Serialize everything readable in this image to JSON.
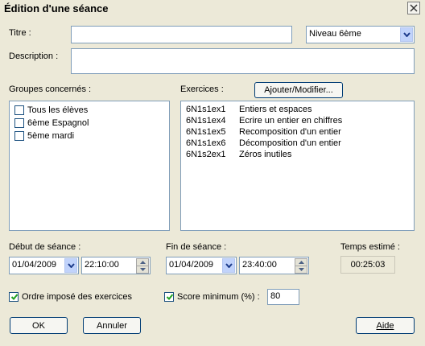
{
  "window": {
    "title": "Édition d'une séance"
  },
  "form": {
    "titre_label": "Titre :",
    "titre_value": "",
    "niveau_value": "Niveau 6ème",
    "description_label": "Description :",
    "description_value": ""
  },
  "groupes": {
    "label": "Groupes concernés :",
    "items": [
      {
        "label": "Tous les élèves",
        "checked": false
      },
      {
        "label": "6ème Espagnol",
        "checked": false
      },
      {
        "label": "5ème mardi",
        "checked": false
      }
    ]
  },
  "exercices": {
    "label": "Exercices :",
    "button_label": "Ajouter/Modifier...",
    "items": [
      {
        "code": "6N1s1ex1",
        "title": "Entiers et espaces"
      },
      {
        "code": "6N1s1ex4",
        "title": "Ecrire un entier en chiffres"
      },
      {
        "code": "6N1s1ex5",
        "title": "Recomposition d'un entier"
      },
      {
        "code": "6N1s1ex6",
        "title": "Décomposition d'un entier"
      },
      {
        "code": "6N1s2ex1",
        "title": "Zéros inutiles"
      }
    ]
  },
  "debut": {
    "label": "Début de séance :",
    "date": "01/04/2009",
    "time": "22:10:00"
  },
  "fin": {
    "label": "Fin de séance :",
    "date": "01/04/2009",
    "time": "23:40:00"
  },
  "temps": {
    "label": "Temps estimé :",
    "value": "00:25:03"
  },
  "options": {
    "ordre_label": "Ordre imposé des exercices",
    "ordre_checked": true,
    "score_label": "Score minimum (%) :",
    "score_checked": true,
    "score_value": "80"
  },
  "buttons": {
    "ok": "OK",
    "annuler": "Annuler",
    "aide": "Aide"
  },
  "icons": {
    "close": "close-icon",
    "dropdown": "chevron-down-icon",
    "spin_up": "spin-up-icon",
    "spin_down": "spin-down-icon",
    "checkmark": "checkmark-icon"
  },
  "colors": {
    "dialog_bg": "#ece9d8",
    "input_border": "#7f9db9",
    "button_border": "#003c74",
    "check_color": "#21a121"
  }
}
